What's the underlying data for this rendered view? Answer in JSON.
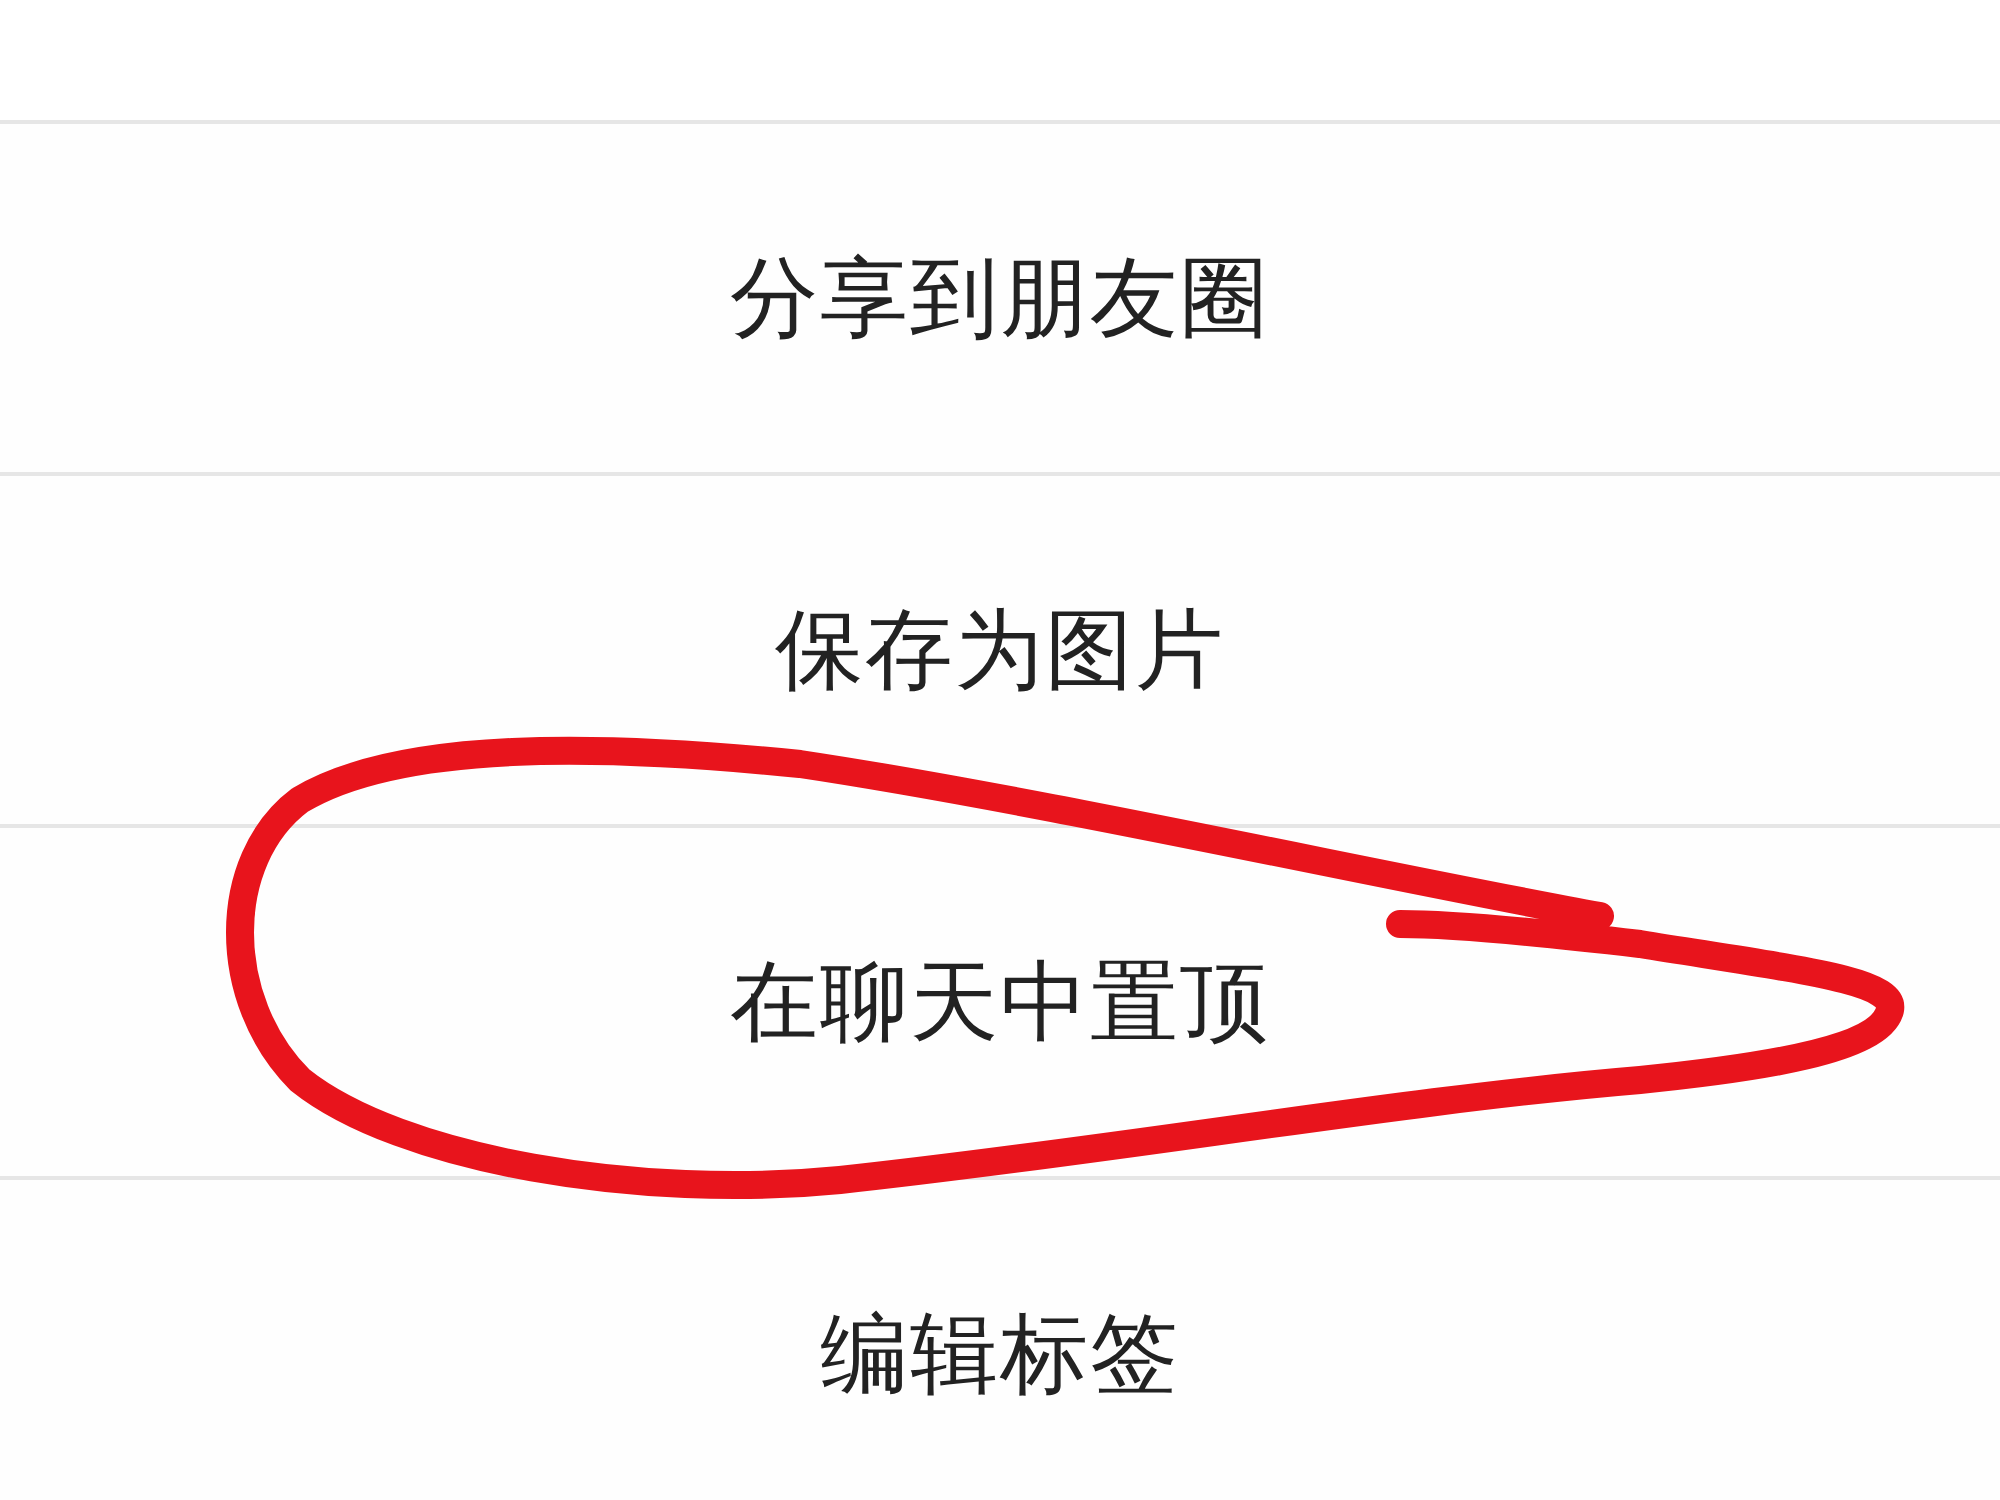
{
  "menu": {
    "items": [
      {
        "label": "分享到朋友圈"
      },
      {
        "label": "保存为图片"
      },
      {
        "label": "在聊天中置顶"
      },
      {
        "label": "编辑标签"
      }
    ]
  }
}
